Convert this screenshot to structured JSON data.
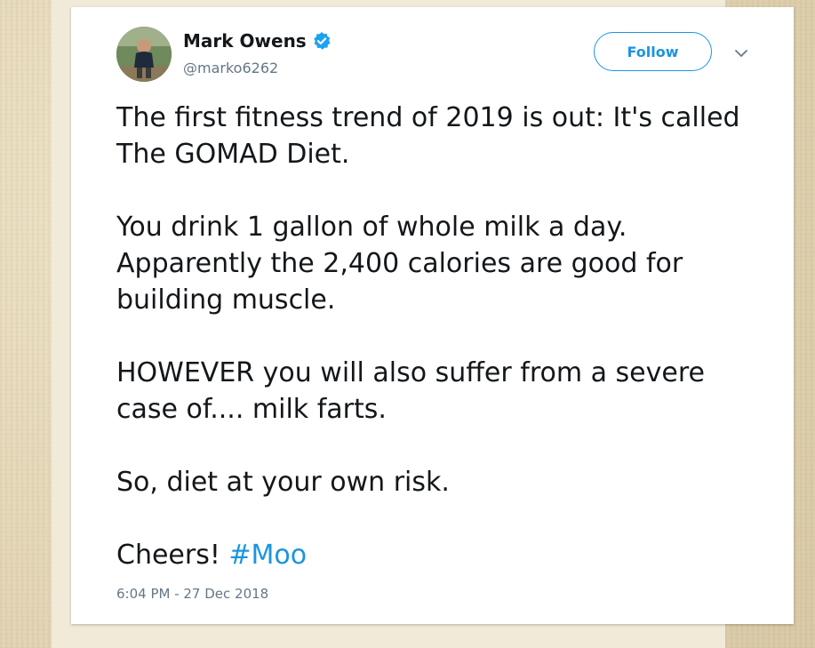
{
  "tweet": {
    "author": {
      "display_name": "Mark Owens",
      "handle": "@marko6262",
      "verified": true,
      "avatar_icon": "profile-photo"
    },
    "follow_label": "Follow",
    "menu_icon": "chevron-down-icon",
    "paragraphs": [
      [
        "The first fitness trend of 2019 is out: It's called",
        "The GOMAD Diet."
      ],
      [
        "You drink 1 gallon of whole milk a day.",
        "Apparently the 2,400 calories are good for",
        "building muscle."
      ],
      [
        "HOWEVER you will also suffer from a severe",
        "case of.... milk farts."
      ],
      [
        "So, diet at your own risk."
      ]
    ],
    "closing_text": "Cheers! ",
    "hashtag": "#Moo",
    "timestamp": "6:04 PM - 27 Dec 2018"
  },
  "colors": {
    "accent": "#1b95e0",
    "text": "#14171a",
    "muted": "#657786",
    "background": "#e8dcc0",
    "card": "#ffffff"
  }
}
